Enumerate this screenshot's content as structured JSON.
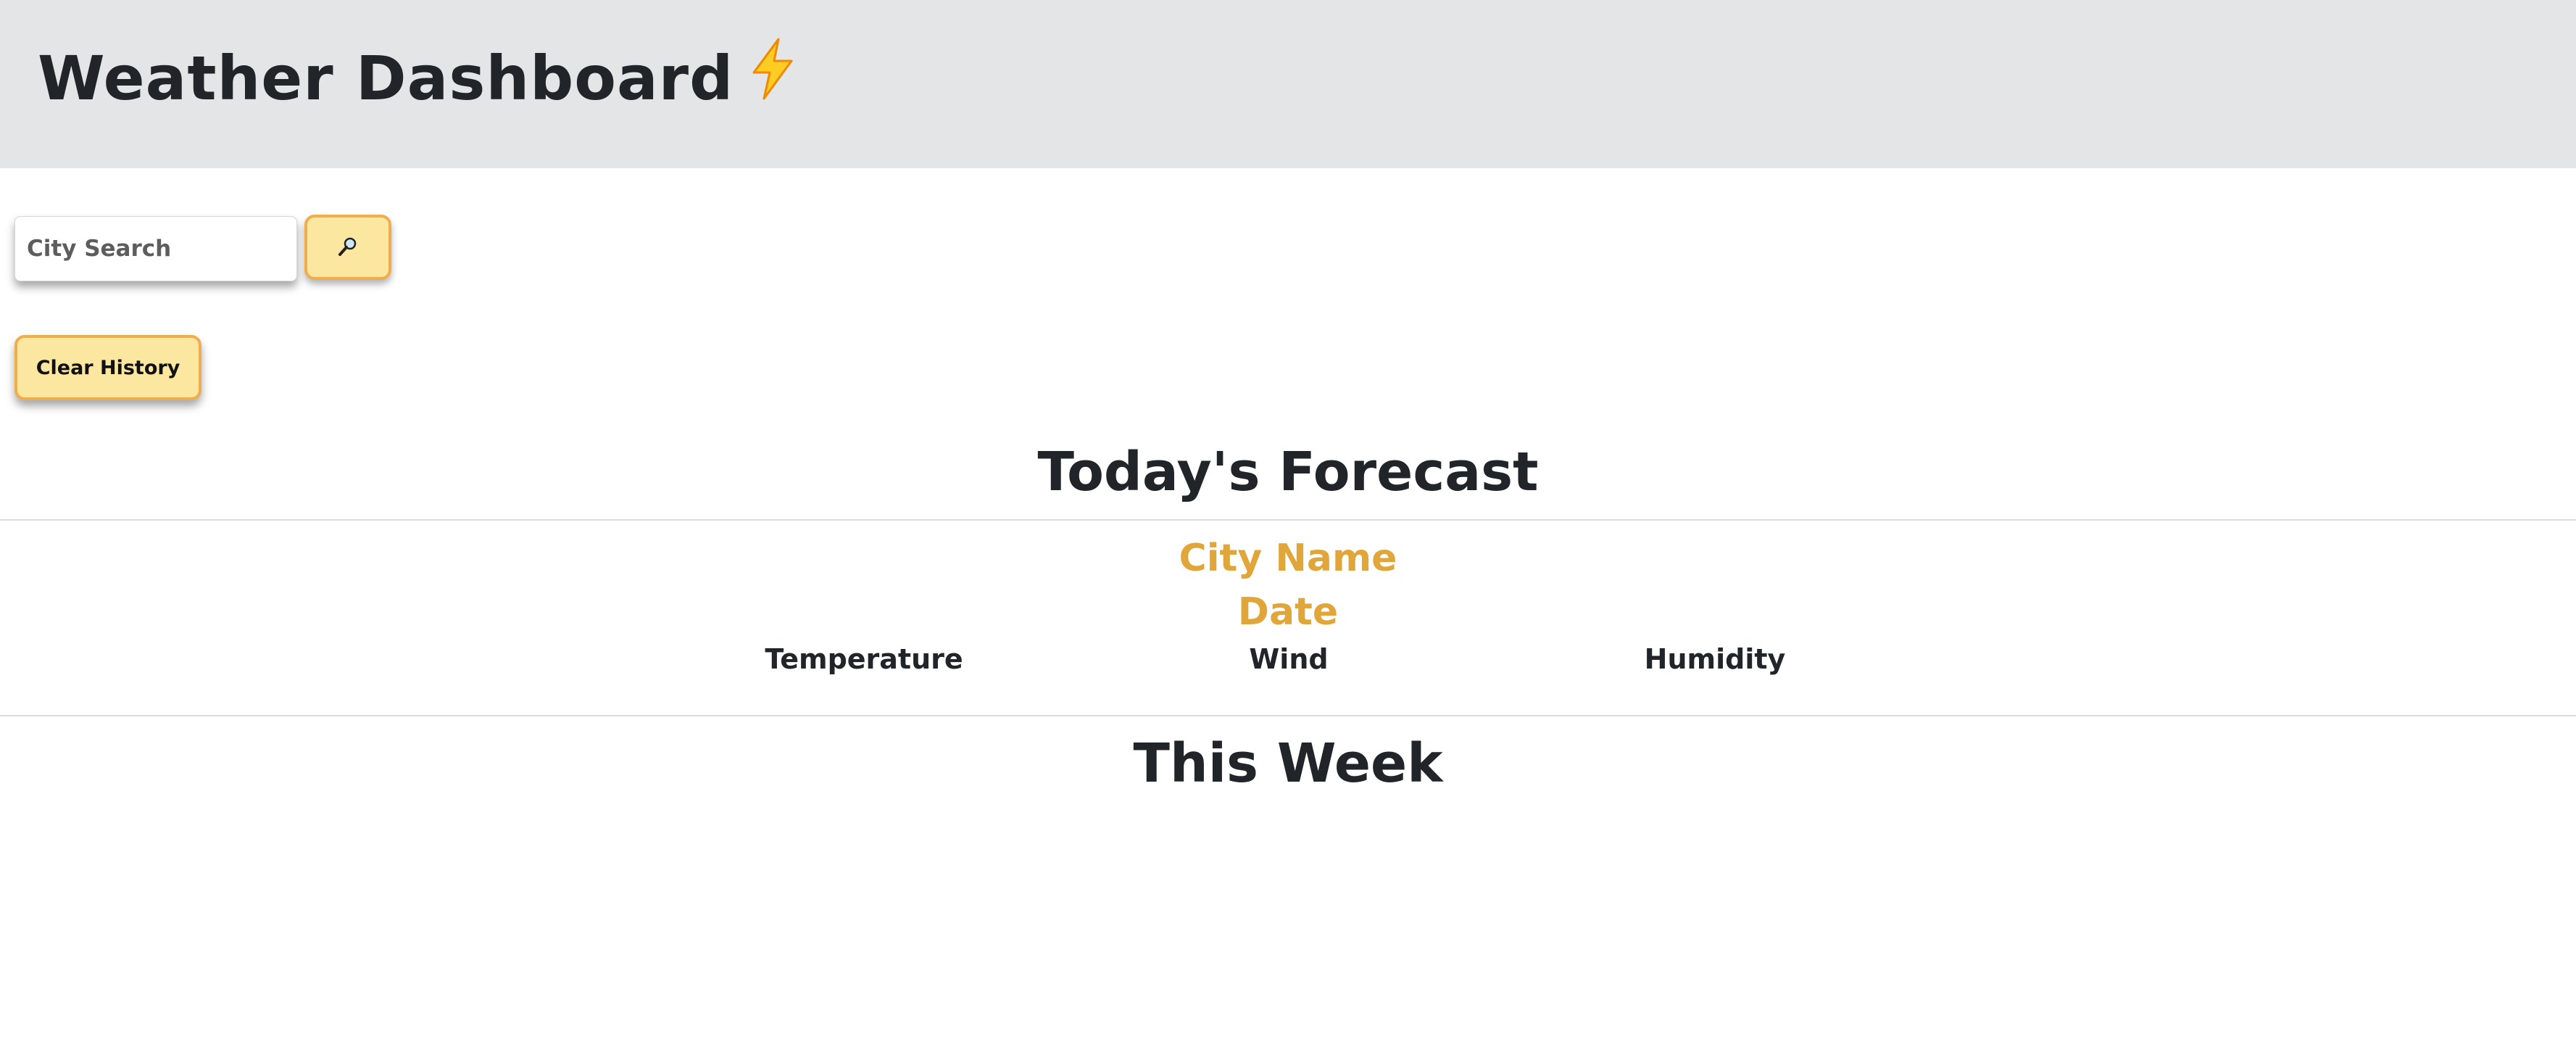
{
  "header": {
    "title": "Weather Dashboard",
    "title_icon": "lightning-bolt-icon",
    "background": "#e4e5e7"
  },
  "search": {
    "placeholder": "City Search",
    "value": "",
    "button_icon": "magnifying-glass-icon"
  },
  "history": {
    "clear_label": "Clear History"
  },
  "today": {
    "heading": "Today's Forecast",
    "city": "City Name",
    "date": "Date",
    "stats": {
      "temperature": "Temperature",
      "wind": "Wind",
      "humidity": "Humidity"
    }
  },
  "week": {
    "heading": "This Week"
  },
  "colors": {
    "accent": "#e0a63a",
    "button_fill": "#fce7a0",
    "button_border": "#f0ad4e",
    "text": "#212529"
  }
}
